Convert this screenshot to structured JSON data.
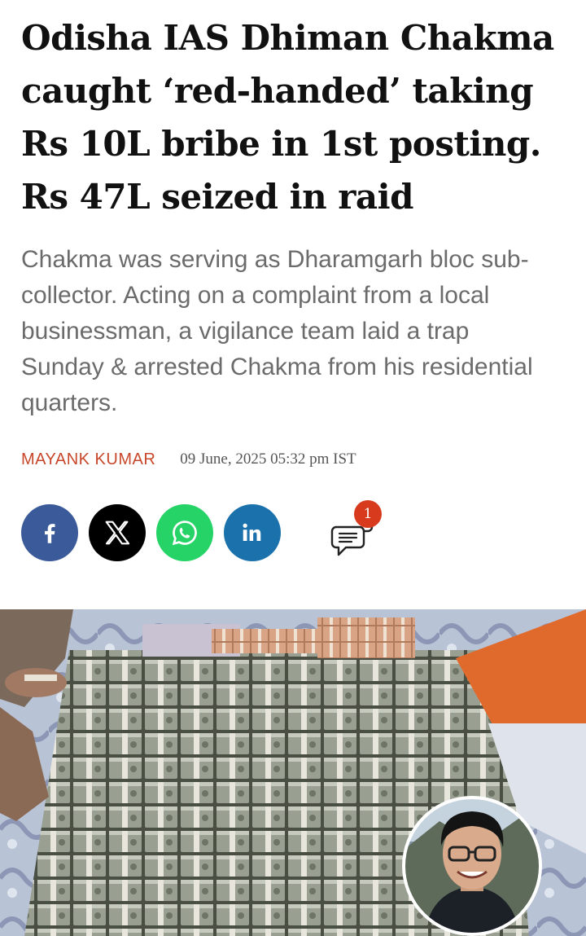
{
  "article": {
    "headline": "Odisha IAS Dhiman Chakma caught ‘red-handed’ taking Rs 10L bribe in 1st posting. Rs 47L seized in raid",
    "summary": "Chakma was serving as Dharamgarh bloc sub-collector. Acting on a complaint from a local businessman, a vigilance team laid a trap Sunday & arrested Chakma from his residential quarters.",
    "author": "MAYANK KUMAR",
    "published": "09 June, 2025 05:32 pm IST"
  },
  "share": {
    "buttons": [
      {
        "name": "facebook",
        "icon": "facebook-icon",
        "color": "#3b5a9a"
      },
      {
        "name": "x",
        "icon": "x-icon",
        "color": "#000000"
      },
      {
        "name": "whatsapp",
        "icon": "whatsapp-icon",
        "color": "#25d366"
      },
      {
        "name": "linkedin",
        "icon": "linkedin-icon",
        "color": "#1a71ab"
      }
    ],
    "comment_count": "1"
  },
  "colors": {
    "author": "#c8472a",
    "badge": "#d83a1d"
  }
}
